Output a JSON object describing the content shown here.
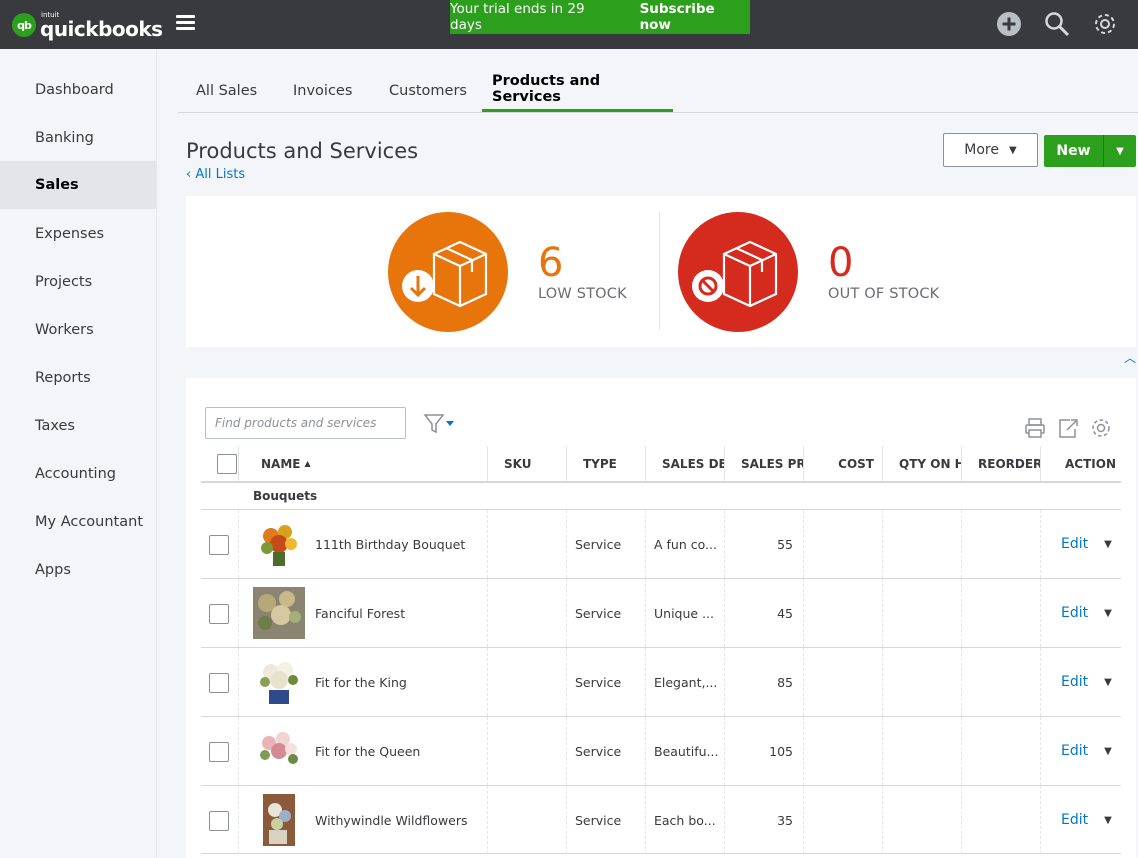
{
  "topbar": {
    "logo_intuit": "intuit",
    "logo_product": "quickbooks",
    "logo_mark": "qb",
    "trial_text": "Your trial ends in 29 days",
    "subscribe_label": "Subscribe now",
    "icons": [
      "plus-icon",
      "search-icon",
      "gear-icon"
    ],
    "colors": {
      "bar": "#393a3d",
      "trial": "#2ca01c"
    }
  },
  "sidebar": {
    "items": [
      {
        "label": "Dashboard"
      },
      {
        "label": "Banking"
      },
      {
        "label": "Sales",
        "active": true
      },
      {
        "label": "Expenses"
      },
      {
        "label": "Projects"
      },
      {
        "label": "Workers"
      },
      {
        "label": "Reports"
      },
      {
        "label": "Taxes"
      },
      {
        "label": "Accounting"
      },
      {
        "label": "My Accountant"
      },
      {
        "label": "Apps"
      }
    ]
  },
  "tabs": [
    {
      "label": "All Sales"
    },
    {
      "label": "Invoices"
    },
    {
      "label": "Customers"
    },
    {
      "label": "Products and Services",
      "active": true
    }
  ],
  "page": {
    "title": "Products and Services",
    "all_lists": "All Lists",
    "more_label": "More",
    "new_label": "New"
  },
  "stock": {
    "low": {
      "count": "6",
      "label": "LOW STOCK",
      "color": "#e8740c"
    },
    "out": {
      "count": "0",
      "label": "OUT OF STOCK",
      "color": "#d52b1e"
    }
  },
  "table": {
    "search_placeholder": "Find products and services",
    "columns": [
      "NAME",
      "SKU",
      "TYPE",
      "SALES DES",
      "SALES PRI",
      "COST",
      "QTY ON H",
      "REORDER",
      "ACTION"
    ],
    "sort_indicator": "▲",
    "group": "Bouquets",
    "rows": [
      {
        "name": "111th Birthday Bouquet",
        "type": "Service",
        "desc": "A fun co...",
        "price": "55",
        "action": "Edit"
      },
      {
        "name": "Fanciful Forest",
        "type": "Service",
        "desc": "Unique ...",
        "price": "45",
        "action": "Edit"
      },
      {
        "name": "Fit for the King",
        "type": "Service",
        "desc": "Elegant,...",
        "price": "85",
        "action": "Edit"
      },
      {
        "name": "Fit for the Queen",
        "type": "Service",
        "desc": "Beautifu...",
        "price": "105",
        "action": "Edit"
      },
      {
        "name": "Withywindle Wildflowers",
        "type": "Service",
        "desc": "Each bo...",
        "price": "35",
        "action": "Edit"
      }
    ]
  }
}
